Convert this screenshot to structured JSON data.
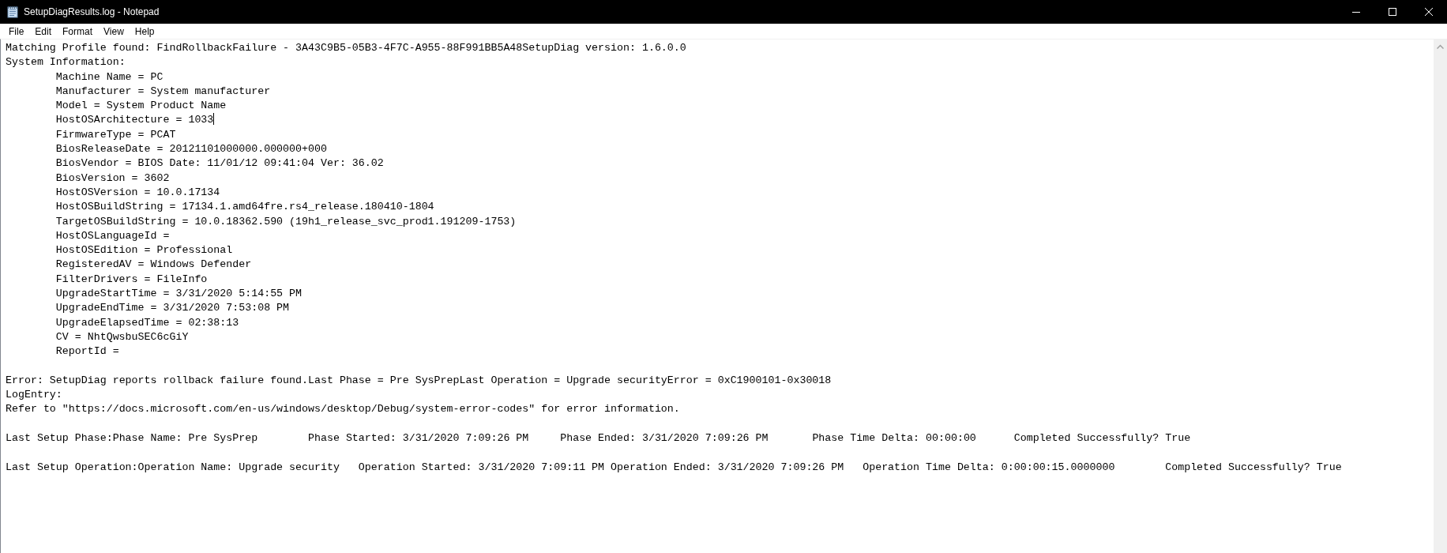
{
  "window": {
    "title": "SetupDiagResults.log - Notepad"
  },
  "menu": [
    "File",
    "Edit",
    "Format",
    "View",
    "Help"
  ],
  "document": {
    "paragraphs": [
      {
        "lines": [
          {
            "text": "Matching Profile found: FindRollbackFailure - 3A43C9B5-05B3-4F7C-A955-88F991BB5A48SetupDiag version: 1.6.0.0"
          },
          {
            "text": "System Information:",
            "children": [
              {
                "text": "Machine Name = PC"
              },
              {
                "text": "Manufacturer = System manufacturer"
              },
              {
                "text": "Model = System Product Name"
              },
              {
                "text": "HostOSArchitecture = 1033",
                "caret": true
              },
              {
                "text": "FirmwareType = PCAT"
              },
              {
                "text": "BiosReleaseDate = 20121101000000.000000+000"
              },
              {
                "text": "BiosVendor = BIOS Date: 11/01/12 09:41:04 Ver: 36.02"
              },
              {
                "text": "BiosVersion = 3602"
              },
              {
                "text": "HostOSVersion = 10.0.17134"
              },
              {
                "text": "HostOSBuildString = 17134.1.amd64fre.rs4_release.180410-1804"
              },
              {
                "text": "TargetOSBuildString = 10.0.18362.590 (19h1_release_svc_prod1.191209-1753)"
              },
              {
                "text": "HostOSLanguageId ="
              },
              {
                "text": "HostOSEdition = Professional"
              },
              {
                "text": "RegisteredAV = Windows Defender"
              },
              {
                "text": "FilterDrivers = FileInfo"
              },
              {
                "text": "UpgradeStartTime = 3/31/2020 5:14:55 PM"
              },
              {
                "text": "UpgradeEndTime = 3/31/2020 7:53:08 PM"
              },
              {
                "text": "UpgradeElapsedTime = 02:38:13"
              },
              {
                "text": "CV = NhtQwsbuSEC6cGiY"
              },
              {
                "text": "ReportId ="
              }
            ]
          }
        ]
      },
      {
        "lines": [
          {
            "text": "Error: SetupDiag reports rollback failure found.Last Phase = Pre SysPrepLast Operation = Upgrade securityError = 0xC1900101-0x30018"
          },
          {
            "text": "LogEntry:"
          },
          {
            "text": "Refer to \"https://docs.microsoft.com/en-us/windows/desktop/Debug/system-error-codes\" for error information."
          }
        ]
      },
      {
        "lines": [
          {
            "text": "Last Setup Phase:Phase Name: Pre SysPrep\tPhase Started: 3/31/2020 7:09:26 PM\tPhase Ended: 3/31/2020 7:09:26 PM\tPhase Time Delta: 00:00:00\tCompleted Successfully? True"
          }
        ]
      },
      {
        "lines": [
          {
            "text": "Last Setup Operation:Operation Name: Upgrade security   Operation Started: 3/31/2020 7:09:11 PM Operation Ended: 3/31/2020 7:09:26 PM   Operation Time Delta: 0:00:00:15.0000000\tCompleted Successfully? True"
          }
        ]
      }
    ]
  }
}
